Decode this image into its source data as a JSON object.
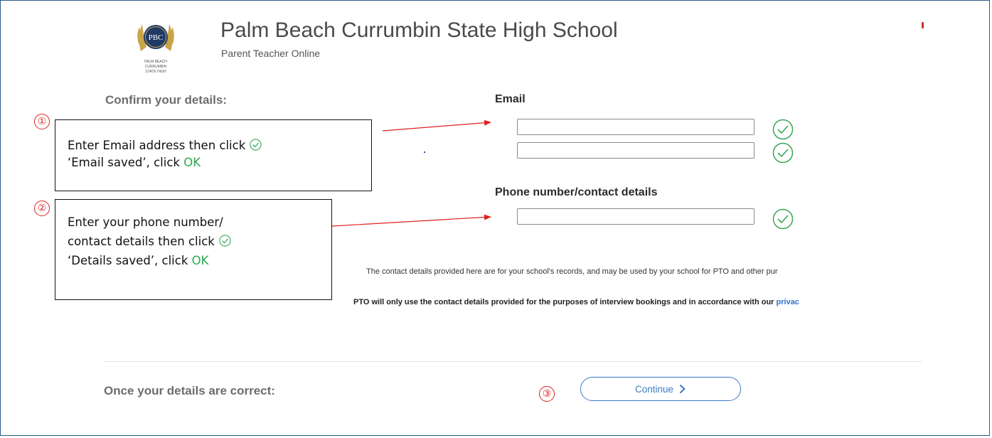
{
  "header": {
    "school_name": "Palm Beach Currumbin State High School",
    "subtitle": "Parent Teacher Online",
    "logo": {
      "monogram": "PBC",
      "lines": [
        "PALM BEACH",
        "CURRUMBIN",
        "STATE HIGH"
      ]
    }
  },
  "sections": {
    "confirm_label": "Confirm your details:",
    "once_label": "Once your details are correct:"
  },
  "email": {
    "label": "Email",
    "input_value": "",
    "confirm_value": ""
  },
  "phone": {
    "label": "Phone number/contact details",
    "input_value": ""
  },
  "callouts": [
    {
      "number": "①",
      "line1": "Enter Email address then click",
      "line2": "‘Email saved’, click ",
      "ok": "OK"
    },
    {
      "number": "②",
      "line1": "Enter your phone number/",
      "line2": "contact details then click",
      "line3": "‘Details saved’, click ",
      "ok": "OK"
    },
    {
      "number": "③"
    }
  ],
  "notes": {
    "records": "The contact details provided here are for your school's records, and may be used by your school for PTO and other pur",
    "pto": "PTO will only use the contact details provided for the purposes of interview bookings and in accordance with our ",
    "privacy_link": "privac"
  },
  "continue_button": {
    "label": "Continue"
  },
  "colors": {
    "check_green": "#3aa655",
    "annotation_red": "#dd2222",
    "button_blue": "#3d7ac7",
    "link_blue": "#2f6fd0"
  }
}
